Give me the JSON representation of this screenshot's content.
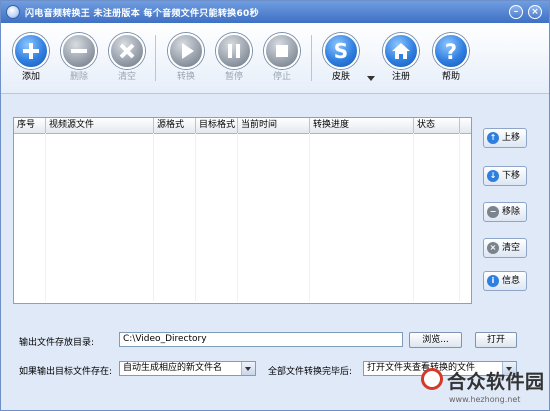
{
  "window": {
    "title": "闪电音频转换王  未注册版本 每个音频文件只能转换60秒",
    "minimize_glyph": "–",
    "close_glyph": "×"
  },
  "toolbar": {
    "add": {
      "label": "添加",
      "icon": "plus-icon",
      "enabled": true
    },
    "remove": {
      "label": "删除",
      "icon": "minus-icon",
      "enabled": false
    },
    "clear": {
      "label": "清空",
      "icon": "x-icon",
      "enabled": false
    },
    "convert": {
      "label": "转换",
      "icon": "play-icon",
      "enabled": false
    },
    "pause": {
      "label": "暂停",
      "icon": "pause-icon",
      "enabled": false
    },
    "stop": {
      "label": "停止",
      "icon": "stop-icon",
      "enabled": false
    },
    "skin": {
      "label": "皮肤",
      "icon": "skin-s-icon",
      "enabled": true
    },
    "register": {
      "label": "注册",
      "icon": "home-icon",
      "enabled": true
    },
    "help": {
      "label": "帮助",
      "icon": "question-icon",
      "enabled": true
    }
  },
  "list": {
    "columns": [
      "序号",
      "视频源文件",
      "源格式",
      "目标格式",
      "当前时间",
      "转换进度",
      "状态"
    ],
    "rows": []
  },
  "side_buttons": {
    "up": "上移",
    "down": "下移",
    "remove": "移除",
    "clear": "清空",
    "info": "信息"
  },
  "output": {
    "dir_label": "输出文件存放目录:",
    "dir_value": "C:\\Video_Directory",
    "browse_label": "浏览...",
    "open_label": "打开",
    "exist_label": "如果输出目标文件存在:",
    "exist_value": "自动生成相应的新文件名",
    "after_label": "全部文件转换完毕后:",
    "after_value": "打开文件夹查看转换的文件"
  },
  "watermark": {
    "text": "合众软件园",
    "url": "www.hezhong.net"
  },
  "colors": {
    "title_bar": "#3e70c4",
    "accent_blue": "#2f7fe0",
    "disabled_gray": "#9aa2ad",
    "window_bg": "#dfe9f7"
  }
}
